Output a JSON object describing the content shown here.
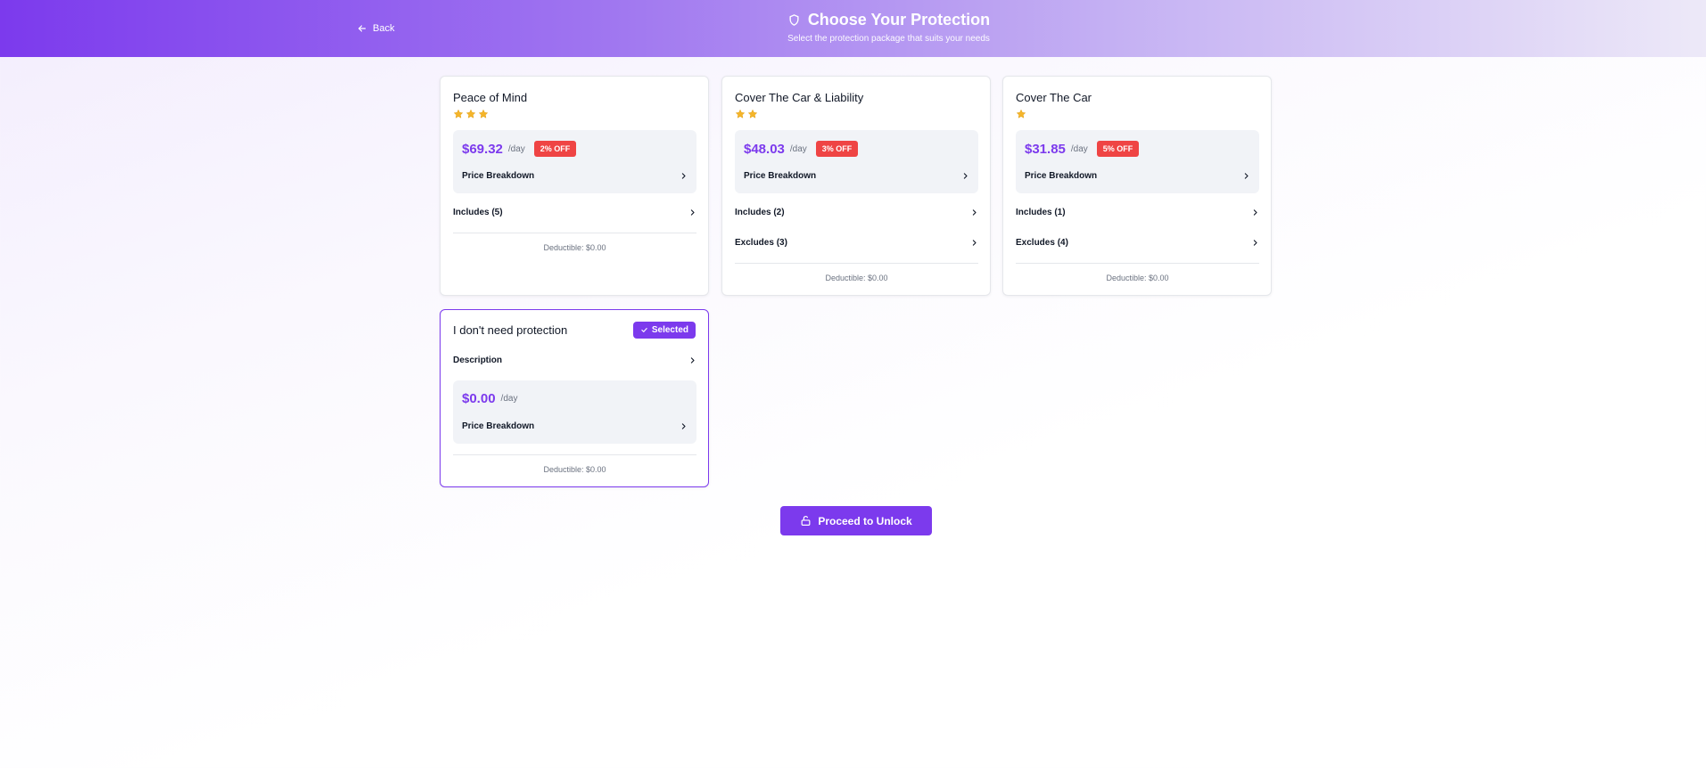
{
  "header": {
    "back_label": "Back",
    "title": "Choose Your Protection",
    "subtitle": "Select the protection package that suits your needs"
  },
  "packages": [
    {
      "name": "Peace of Mind",
      "stars": 3,
      "price": "$69.32",
      "per_day": "/day",
      "discount": "2% OFF",
      "breakdown_label": "Price Breakdown",
      "includes_label": "Includes (5)",
      "deductible": "Deductible: $0.00"
    },
    {
      "name": "Cover The Car & Liability",
      "stars": 2,
      "price": "$48.03",
      "per_day": "/day",
      "discount": "3% OFF",
      "breakdown_label": "Price Breakdown",
      "includes_label": "Includes (2)",
      "excludes_label": "Excludes (3)",
      "deductible": "Deductible: $0.00"
    },
    {
      "name": "Cover The Car",
      "stars": 1,
      "price": "$31.85",
      "per_day": "/day",
      "discount": "5% OFF",
      "breakdown_label": "Price Breakdown",
      "includes_label": "Includes (1)",
      "excludes_label": "Excludes (4)",
      "deductible": "Deductible: $0.00"
    },
    {
      "name": "I don't need protection",
      "selected_label": "Selected",
      "description_label": "Description",
      "price": "$0.00",
      "per_day": "/day",
      "breakdown_label": "Price Breakdown",
      "deductible": "Deductible: $0.00"
    }
  ],
  "proceed_label": "Proceed to Unlock",
  "colors": {
    "accent": "#7c3aed",
    "discount": "#ef4444",
    "star": "#f5b52a",
    "price_box": "#f1f3f7"
  }
}
